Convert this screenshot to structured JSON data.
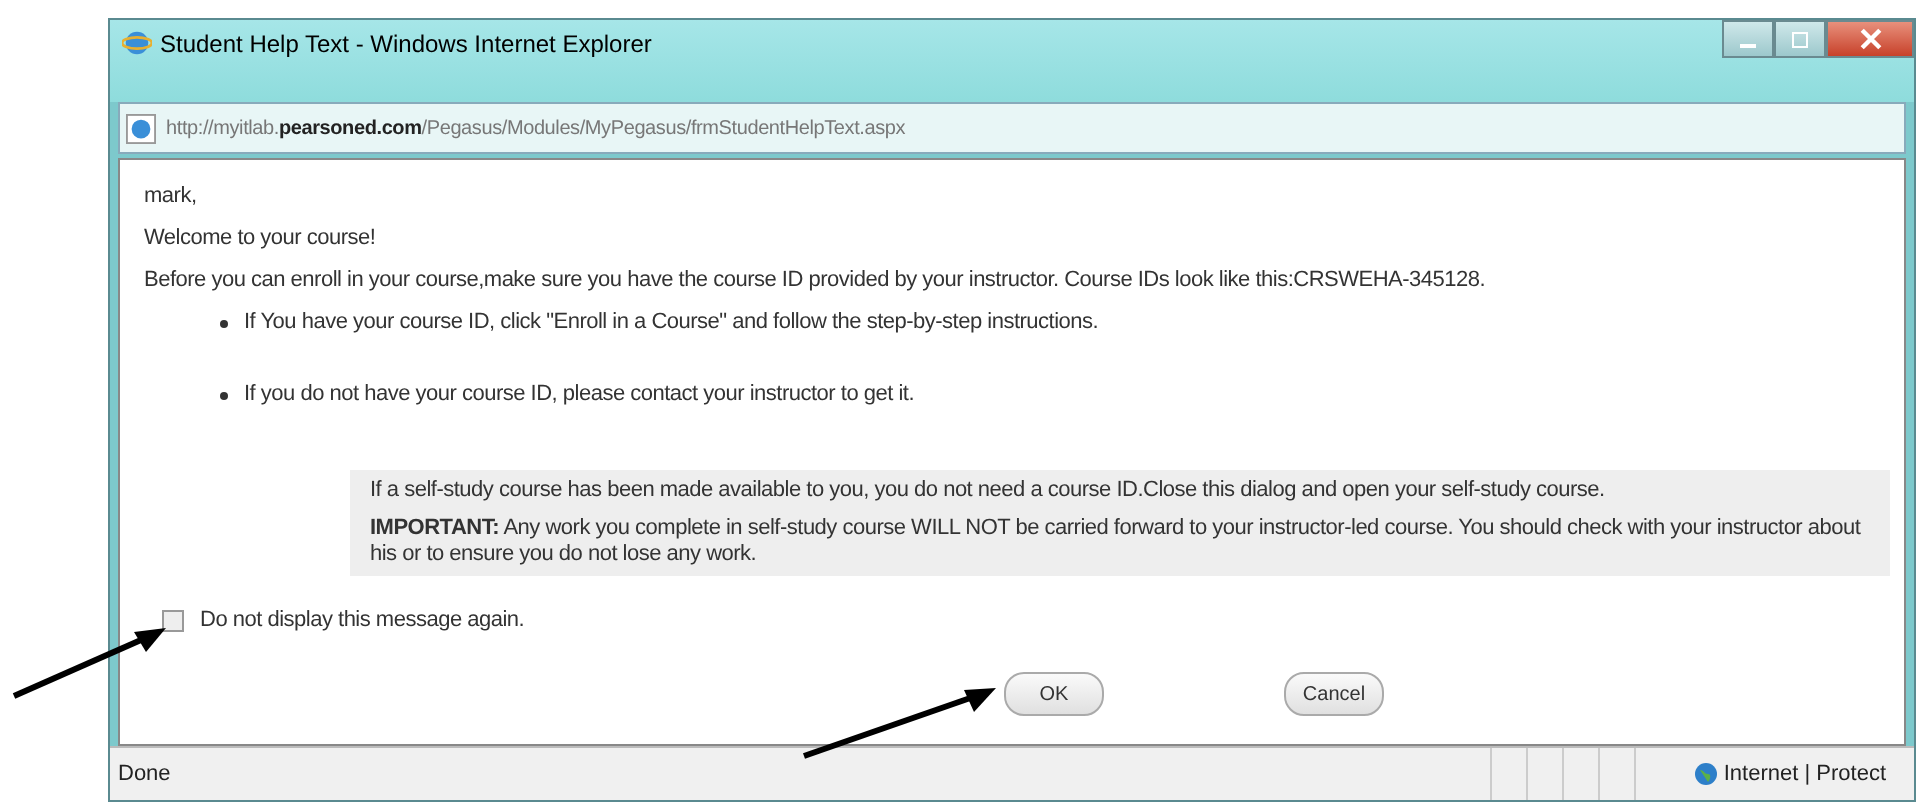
{
  "window": {
    "title": "Student Help Text - Windows Internet Explorer"
  },
  "address_bar": {
    "url": "http://myitlab.**pearsoned.com**/Pegasus/Modules/MyPegasus/frmStudentHelpText.aspx"
  },
  "content": {
    "greeting": "mark,",
    "welcome": "Welcome to your course!",
    "intro": "Before you can enroll in your course,make sure you have the course ID provided by your instructor. Course IDs look like this:CRSWEHA-345128.",
    "bullets": [
      "If You have your course ID, click \"Enroll in a Course\" and follow the step-by-step instructions.",
      "If you do not have your course ID, please contact your instructor to get it."
    ],
    "note": [
      "If a self-study course has been made available to you, you do not need a course ID.Close this dialog and open your self-study course.",
      "**IMPORTANT:**  Any work you complete in self-study course WILL NOT be carried forward to your instructor-led course. You should check with your instructor about his or to ensure you do not lose any work."
    ],
    "checkbox": {
      "label": "Do not display this message again.",
      "checked": false
    },
    "buttons": [
      "OK",
      "Cancel"
    ]
  },
  "status_bar": {
    "text": "Done",
    "zone": "Internet | Protect"
  }
}
